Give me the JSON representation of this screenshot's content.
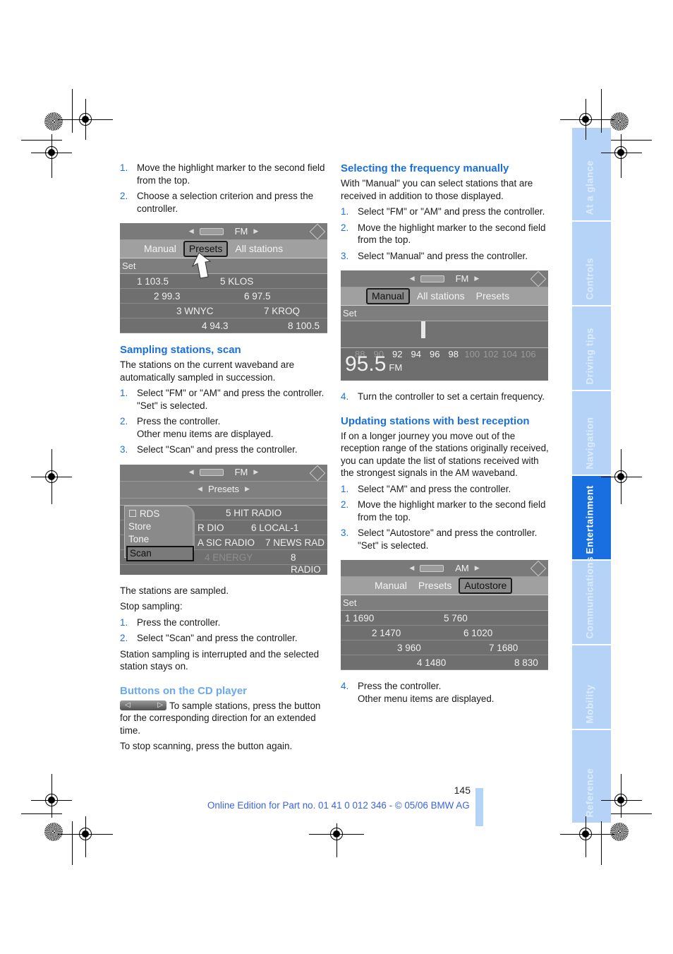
{
  "left_column": {
    "intro_steps": [
      {
        "num": "1.",
        "text": "Move the highlight marker to the second field from the top."
      },
      {
        "num": "2.",
        "text": "Choose a selection criterion and press the controller."
      }
    ],
    "screen1": {
      "band": "FM",
      "tabs": [
        "Manual",
        "Presets",
        "All stations"
      ],
      "selected_tab": "Presets",
      "set_label": "Set",
      "presets": [
        {
          "left": "1 103.5",
          "right": "5 KLOS"
        },
        {
          "left": "2 99.3",
          "right": "6 97.5"
        },
        {
          "left": "3 WNYC",
          "right": "7 KROQ"
        },
        {
          "left": "4 94.3",
          "right": "8 100.5"
        }
      ]
    },
    "sampling": {
      "heading": "Sampling stations, scan",
      "intro": "The stations on the current waveband are automatically sampled in succession.",
      "steps": [
        {
          "num": "1.",
          "text": "Select \"FM\" or \"AM\" and press the controller.",
          "sub": "\"Set\" is selected."
        },
        {
          "num": "2.",
          "text": "Press the controller.",
          "sub": "Other menu items are displayed."
        },
        {
          "num": "3.",
          "text": "Select \"Scan\" and press the controller.",
          "sub": ""
        }
      ]
    },
    "screen2": {
      "band": "FM",
      "submenu": "Presets",
      "menu_items": [
        "RDS",
        "Store",
        "Tone",
        "Scan"
      ],
      "selected_item": "Scan",
      "rows": [
        {
          "left": "",
          "right": "5 HIT RADIO"
        },
        {
          "left": "R DIO",
          "right": "6 LOCAL-1"
        },
        {
          "left": "A SIC RADIO",
          "right": "7 NEWS RAD"
        },
        {
          "left": "4 ENERGY",
          "right": "8 RADIO"
        }
      ]
    },
    "after_scan": {
      "line1": "The stations are sampled.",
      "line2": "Stop sampling:",
      "steps": [
        {
          "num": "1.",
          "text": "Press the controller."
        },
        {
          "num": "2.",
          "text": "Select \"Scan\" and press the controller."
        }
      ],
      "outro": "Station sampling is interrupted and the selected station stays on."
    },
    "cd_buttons": {
      "heading": "Buttons on the CD player",
      "button_left": "◁",
      "button_right": "▷",
      "text1": "To sample stations, press the button for the corresponding direction for an extended time.",
      "text2": "To stop scanning, press the button again."
    }
  },
  "right_column": {
    "manual": {
      "heading": "Selecting the frequency manually",
      "intro": "With \"Manual\" you can select stations that are received in addition to those displayed.",
      "steps": [
        {
          "num": "1.",
          "text": "Select \"FM\" or \"AM\" and press the controller."
        },
        {
          "num": "2.",
          "text": "Move the highlight marker to the second field from the top."
        },
        {
          "num": "3.",
          "text": "Select \"Manual\" and press the controller."
        }
      ],
      "step4": {
        "num": "4.",
        "text": "Turn the controller to set a certain frequency."
      }
    },
    "screen3": {
      "band": "FM",
      "tabs": [
        "Manual",
        "All stations",
        "Presets"
      ],
      "selected_tab": "Manual",
      "set_label": "Set",
      "scale": [
        "88",
        "90",
        "92",
        "94",
        "96",
        "98",
        "100",
        "102",
        "104",
        "106"
      ],
      "scale_highlighted": [
        "92",
        "94",
        "96",
        "98"
      ],
      "frequency": "95.5",
      "frequency_unit": "FM"
    },
    "update": {
      "heading": "Updating stations with best reception",
      "intro": "If on a longer journey you move out of the reception range of the stations originally received, you can update the list of stations received with the strongest signals in the AM waveband.",
      "steps": [
        {
          "num": "1.",
          "text": "Select \"AM\" and press the controller.",
          "sub": ""
        },
        {
          "num": "2.",
          "text": "Move the highlight marker to the second field from the top.",
          "sub": ""
        },
        {
          "num": "3.",
          "text": "Select \"Autostore\" and press the controller.",
          "sub": "\"Set\" is selected."
        }
      ],
      "step4": {
        "num": "4.",
        "text": "Press the controller.",
        "sub": "Other menu items are displayed."
      }
    },
    "screen4": {
      "band": "AM",
      "tabs": [
        "Manual",
        "Presets",
        "Autostore"
      ],
      "selected_tab": "Autostore",
      "set_label": "Set",
      "presets": [
        {
          "left": "1 1690",
          "right": "5 760"
        },
        {
          "left": "2 1470",
          "right": "6 1020"
        },
        {
          "left": "3 960",
          "right": "7 1680"
        },
        {
          "left": "4 1480",
          "right": "8 830"
        }
      ]
    }
  },
  "sidebar": {
    "tabs": [
      "At a glance",
      "Controls",
      "Driving tips",
      "Navigation",
      "Entertainment",
      "Communications",
      "Mobility",
      "Reference"
    ],
    "active": "Entertainment",
    "colors": {
      "inactive": "#b5d3f6",
      "active": "#1a6fe0"
    }
  },
  "footer": {
    "page_number": "145",
    "edition": "Online Edition for Part no. 01 41 0 012 346 - © 05/06 BMW AG"
  },
  "colors": {
    "heading": "#1a6fe0",
    "heading_light": "#6aa8ef",
    "footer_text": "#3a63e0"
  }
}
